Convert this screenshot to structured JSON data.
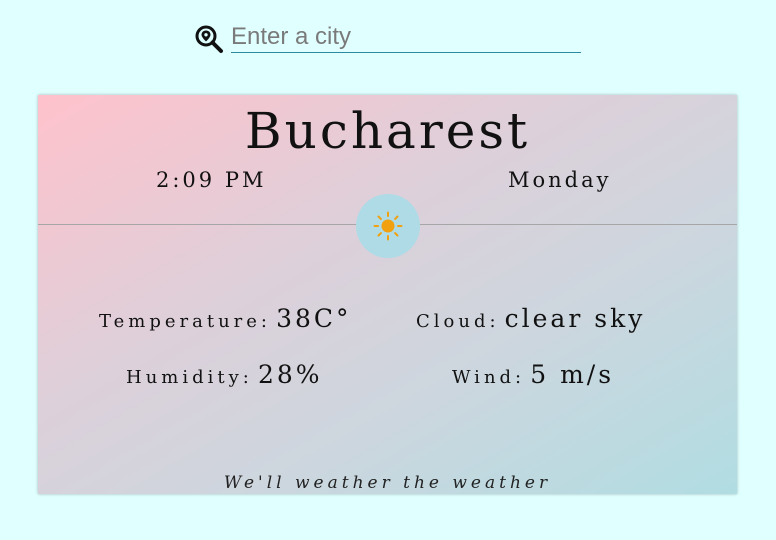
{
  "search": {
    "placeholder": "Enter a city",
    "icon": "location-search-icon"
  },
  "weather": {
    "city": "Bucharest",
    "time": "2:09 PM",
    "day": "Monday",
    "condition_icon": "sun-icon",
    "stats": {
      "temperature_label": "Temperature:",
      "temperature_value": "38C°",
      "cloud_label": "Cloud:",
      "cloud_value": "clear sky",
      "humidity_label": "Humidity:",
      "humidity_value": "28%",
      "wind_label": "Wind:",
      "wind_value": "5 m/s"
    },
    "tagline": "We'll weather the weather"
  },
  "colors": {
    "page_background": "#e0ffff",
    "card_gradient_start": "#ffc2cc",
    "card_gradient_end": "#b0dde2",
    "icon_circle": "#aedbe6",
    "sun": "#f0a010"
  }
}
